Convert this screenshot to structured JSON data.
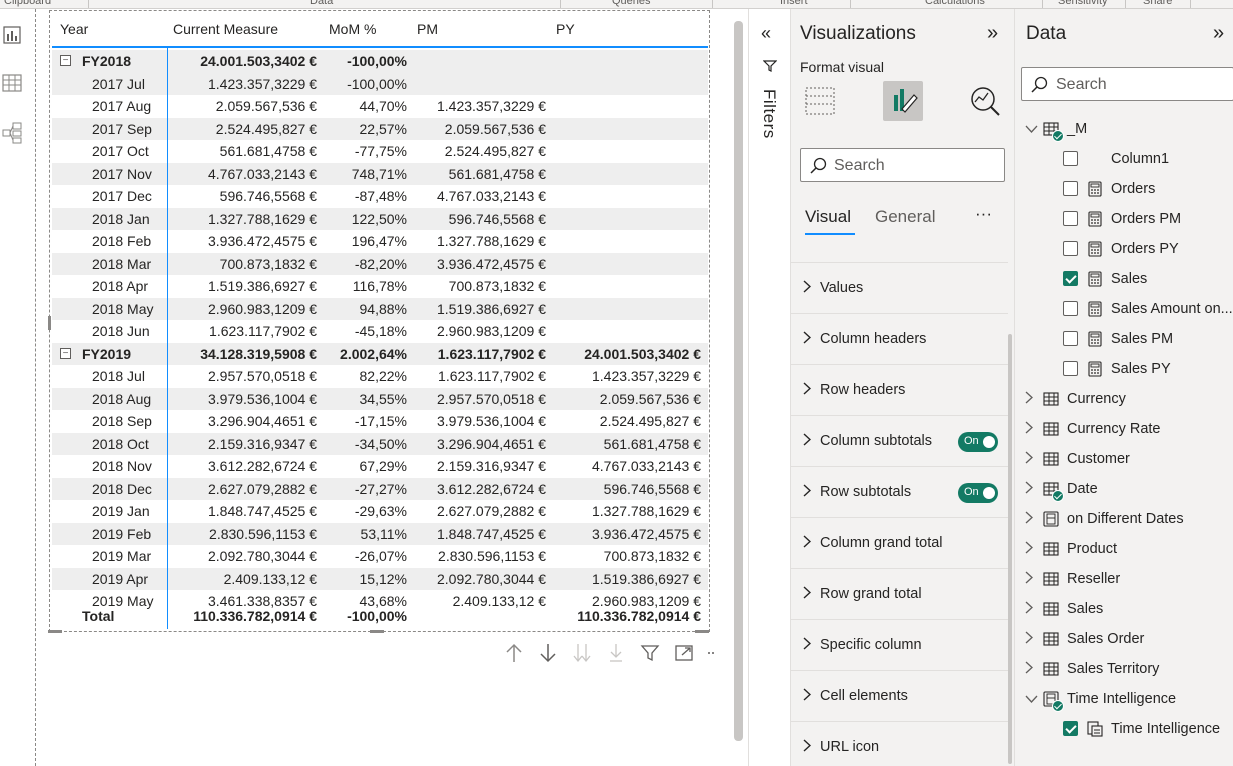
{
  "ribbon": {
    "groups": [
      "Clipboard",
      "Data",
      "Queries",
      "Insert",
      "Calculations",
      "Sensitivity",
      "Share"
    ]
  },
  "matrix": {
    "headers": [
      "Year",
      "Current Measure",
      "MoM %",
      "PM",
      "PY"
    ],
    "rows": [
      {
        "type": "fy",
        "year": "FY2018",
        "cm": "24.001.503,3402 €",
        "mom": "-100,00%",
        "pm": "",
        "py": ""
      },
      {
        "type": "m",
        "year": "2017 Jul",
        "cm": "1.423.357,3229 €",
        "mom": "-100,00%",
        "pm": "",
        "py": ""
      },
      {
        "type": "m",
        "year": "2017 Aug",
        "cm": "2.059.567,536 €",
        "mom": "44,70%",
        "pm": "1.423.357,3229 €",
        "py": ""
      },
      {
        "type": "m",
        "year": "2017 Sep",
        "cm": "2.524.495,827 €",
        "mom": "22,57%",
        "pm": "2.059.567,536 €",
        "py": ""
      },
      {
        "type": "m",
        "year": "2017 Oct",
        "cm": "561.681,4758 €",
        "mom": "-77,75%",
        "pm": "2.524.495,827 €",
        "py": ""
      },
      {
        "type": "m",
        "year": "2017 Nov",
        "cm": "4.767.033,2143 €",
        "mom": "748,71%",
        "pm": "561.681,4758 €",
        "py": ""
      },
      {
        "type": "m",
        "year": "2017 Dec",
        "cm": "596.746,5568 €",
        "mom": "-87,48%",
        "pm": "4.767.033,2143 €",
        "py": ""
      },
      {
        "type": "m",
        "year": "2018 Jan",
        "cm": "1.327.788,1629 €",
        "mom": "122,50%",
        "pm": "596.746,5568 €",
        "py": ""
      },
      {
        "type": "m",
        "year": "2018 Feb",
        "cm": "3.936.472,4575 €",
        "mom": "196,47%",
        "pm": "1.327.788,1629 €",
        "py": ""
      },
      {
        "type": "m",
        "year": "2018 Mar",
        "cm": "700.873,1832 €",
        "mom": "-82,20%",
        "pm": "3.936.472,4575 €",
        "py": ""
      },
      {
        "type": "m",
        "year": "2018 Apr",
        "cm": "1.519.386,6927 €",
        "mom": "116,78%",
        "pm": "700.873,1832 €",
        "py": ""
      },
      {
        "type": "m",
        "year": "2018 May",
        "cm": "2.960.983,1209 €",
        "mom": "94,88%",
        "pm": "1.519.386,6927 €",
        "py": ""
      },
      {
        "type": "m",
        "year": "2018 Jun",
        "cm": "1.623.117,7902 €",
        "mom": "-45,18%",
        "pm": "2.960.983,1209 €",
        "py": ""
      },
      {
        "type": "fy",
        "year": "FY2019",
        "cm": "34.128.319,5908 €",
        "mom": "2.002,64%",
        "pm": "1.623.117,7902 €",
        "py": "24.001.503,3402 €"
      },
      {
        "type": "m",
        "year": "2018 Jul",
        "cm": "2.957.570,0518 €",
        "mom": "82,22%",
        "pm": "1.623.117,7902 €",
        "py": "1.423.357,3229 €"
      },
      {
        "type": "m",
        "year": "2018 Aug",
        "cm": "3.979.536,1004 €",
        "mom": "34,55%",
        "pm": "2.957.570,0518 €",
        "py": "2.059.567,536 €"
      },
      {
        "type": "m",
        "year": "2018 Sep",
        "cm": "3.296.904,4651 €",
        "mom": "-17,15%",
        "pm": "3.979.536,1004 €",
        "py": "2.524.495,827 €"
      },
      {
        "type": "m",
        "year": "2018 Oct",
        "cm": "2.159.316,9347 €",
        "mom": "-34,50%",
        "pm": "3.296.904,4651 €",
        "py": "561.681,4758 €"
      },
      {
        "type": "m",
        "year": "2018 Nov",
        "cm": "3.612.282,6724 €",
        "mom": "67,29%",
        "pm": "2.159.316,9347 €",
        "py": "4.767.033,2143 €"
      },
      {
        "type": "m",
        "year": "2018 Dec",
        "cm": "2.627.079,2882 €",
        "mom": "-27,27%",
        "pm": "3.612.282,6724 €",
        "py": "596.746,5568 €"
      },
      {
        "type": "m",
        "year": "2019 Jan",
        "cm": "1.848.747,4525 €",
        "mom": "-29,63%",
        "pm": "2.627.079,2882 €",
        "py": "1.327.788,1629 €"
      },
      {
        "type": "m",
        "year": "2019 Feb",
        "cm": "2.830.596,1153 €",
        "mom": "53,11%",
        "pm": "1.848.747,4525 €",
        "py": "3.936.472,4575 €"
      },
      {
        "type": "m",
        "year": "2019 Mar",
        "cm": "2.092.780,3044 €",
        "mom": "-26,07%",
        "pm": "2.830.596,1153 €",
        "py": "700.873,1832 €"
      },
      {
        "type": "m",
        "year": "2019 Apr",
        "cm": "2.409.133,12 €",
        "mom": "15,12%",
        "pm": "2.092.780,3044 €",
        "py": "1.519.386,6927 €"
      },
      {
        "type": "m",
        "year": "2019 May",
        "cm": "3.461.338,8357 €",
        "mom": "43,68%",
        "pm": "2.409.133,12 €",
        "py": "2.960.983,1209 €"
      }
    ],
    "total": {
      "year": "Total",
      "cm": "110.336.782,0914 €",
      "mom": "-100,00%",
      "pm": "",
      "py": "110.336.782,0914 €"
    },
    "expander_symbol": "−"
  },
  "filters": {
    "label": "Filters"
  },
  "visualizations": {
    "title": "Visualizations",
    "subtitle": "Format visual",
    "search_placeholder": "Search",
    "tab_visual": "Visual",
    "tab_general": "General",
    "more": "···",
    "sections": [
      {
        "label": "Values",
        "toggle": false
      },
      {
        "label": "Column headers",
        "toggle": false
      },
      {
        "label": "Row headers",
        "toggle": false
      },
      {
        "label": "Column subtotals",
        "toggle": true,
        "toggle_label": "On"
      },
      {
        "label": "Row subtotals",
        "toggle": true,
        "toggle_label": "On"
      },
      {
        "label": "Column grand total",
        "toggle": false
      },
      {
        "label": "Row grand total",
        "toggle": false
      },
      {
        "label": "Specific column",
        "toggle": false
      },
      {
        "label": "Cell elements",
        "toggle": false
      },
      {
        "label": "URL icon",
        "toggle": false
      }
    ]
  },
  "data_pane": {
    "title": "Data",
    "search_placeholder": "Search",
    "items": [
      {
        "label": "_M",
        "level": 0,
        "chev": "v",
        "icon": "table",
        "checked": null,
        "badge": true
      },
      {
        "label": "Column1",
        "level": 1,
        "chev": "",
        "icon": "none",
        "checked": false
      },
      {
        "label": "Orders",
        "level": 1,
        "chev": "",
        "icon": "calc",
        "checked": false
      },
      {
        "label": "Orders PM",
        "level": 1,
        "chev": "",
        "icon": "calc",
        "checked": false
      },
      {
        "label": "Orders PY",
        "level": 1,
        "chev": "",
        "icon": "calc",
        "checked": false
      },
      {
        "label": "Sales",
        "level": 1,
        "chev": "",
        "icon": "calc",
        "checked": true
      },
      {
        "label": "Sales Amount on...",
        "level": 1,
        "chev": "",
        "icon": "calc",
        "checked": false
      },
      {
        "label": "Sales PM",
        "level": 1,
        "chev": "",
        "icon": "calc",
        "checked": false
      },
      {
        "label": "Sales PY",
        "level": 1,
        "chev": "",
        "icon": "calc",
        "checked": false
      },
      {
        "label": "Currency",
        "level": 0,
        "chev": ">",
        "icon": "table",
        "checked": null
      },
      {
        "label": "Currency Rate",
        "level": 0,
        "chev": ">",
        "icon": "table",
        "checked": null
      },
      {
        "label": "Customer",
        "level": 0,
        "chev": ">",
        "icon": "table",
        "checked": null
      },
      {
        "label": "Date",
        "level": 0,
        "chev": ">",
        "icon": "table",
        "checked": null,
        "badge": true
      },
      {
        "label": "on Different Dates",
        "level": 0,
        "chev": ">",
        "icon": "calctable",
        "checked": null
      },
      {
        "label": "Product",
        "level": 0,
        "chev": ">",
        "icon": "table",
        "checked": null
      },
      {
        "label": "Reseller",
        "level": 0,
        "chev": ">",
        "icon": "table",
        "checked": null
      },
      {
        "label": "Sales",
        "level": 0,
        "chev": ">",
        "icon": "table",
        "checked": null
      },
      {
        "label": "Sales Order",
        "level": 0,
        "chev": ">",
        "icon": "table",
        "checked": null
      },
      {
        "label": "Sales Territory",
        "level": 0,
        "chev": ">",
        "icon": "table",
        "checked": null
      },
      {
        "label": "Time Intelligence",
        "level": 0,
        "chev": "v",
        "icon": "calctable",
        "checked": null,
        "badge": true
      },
      {
        "label": "Time Intelligence",
        "level": 1,
        "chev": "",
        "icon": "calcgroup",
        "checked": true
      }
    ]
  },
  "colors": {
    "accent": "#118dff",
    "toggle": "#137a64",
    "band": "#eeeeee",
    "pane": "#f3f2f1"
  }
}
